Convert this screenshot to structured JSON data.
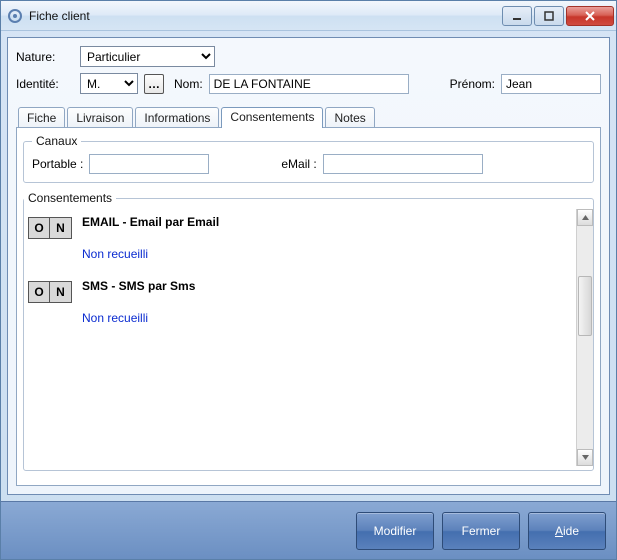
{
  "window": {
    "title": "Fiche client"
  },
  "form": {
    "nature_label": "Nature:",
    "nature_value": "Particulier",
    "identite_label": "Identité:",
    "title_value": "M.",
    "nom_label": "Nom:",
    "nom_value": "DE LA FONTAINE",
    "prenom_label": "Prénom:",
    "prenom_value": "Jean"
  },
  "tabs": {
    "fiche": "Fiche",
    "livraison": "Livraison",
    "informations": "Informations",
    "consentements": "Consentements",
    "notes": "Notes"
  },
  "canaux": {
    "legend": "Canaux",
    "portable_label": "Portable :",
    "portable_value": "",
    "email_label": "eMail :",
    "email_value": ""
  },
  "consents": {
    "legend": "Consentements",
    "toggle_o": "O",
    "toggle_n": "N",
    "items": [
      {
        "title": "EMAIL - Email par Email",
        "status": "Non recueilli"
      },
      {
        "title": "SMS - SMS par Sms",
        "status": "Non recueilli"
      }
    ]
  },
  "footer": {
    "modifier": "Modifier",
    "fermer": "Fermer",
    "aide_u": "A",
    "aide_rest": "ide"
  }
}
